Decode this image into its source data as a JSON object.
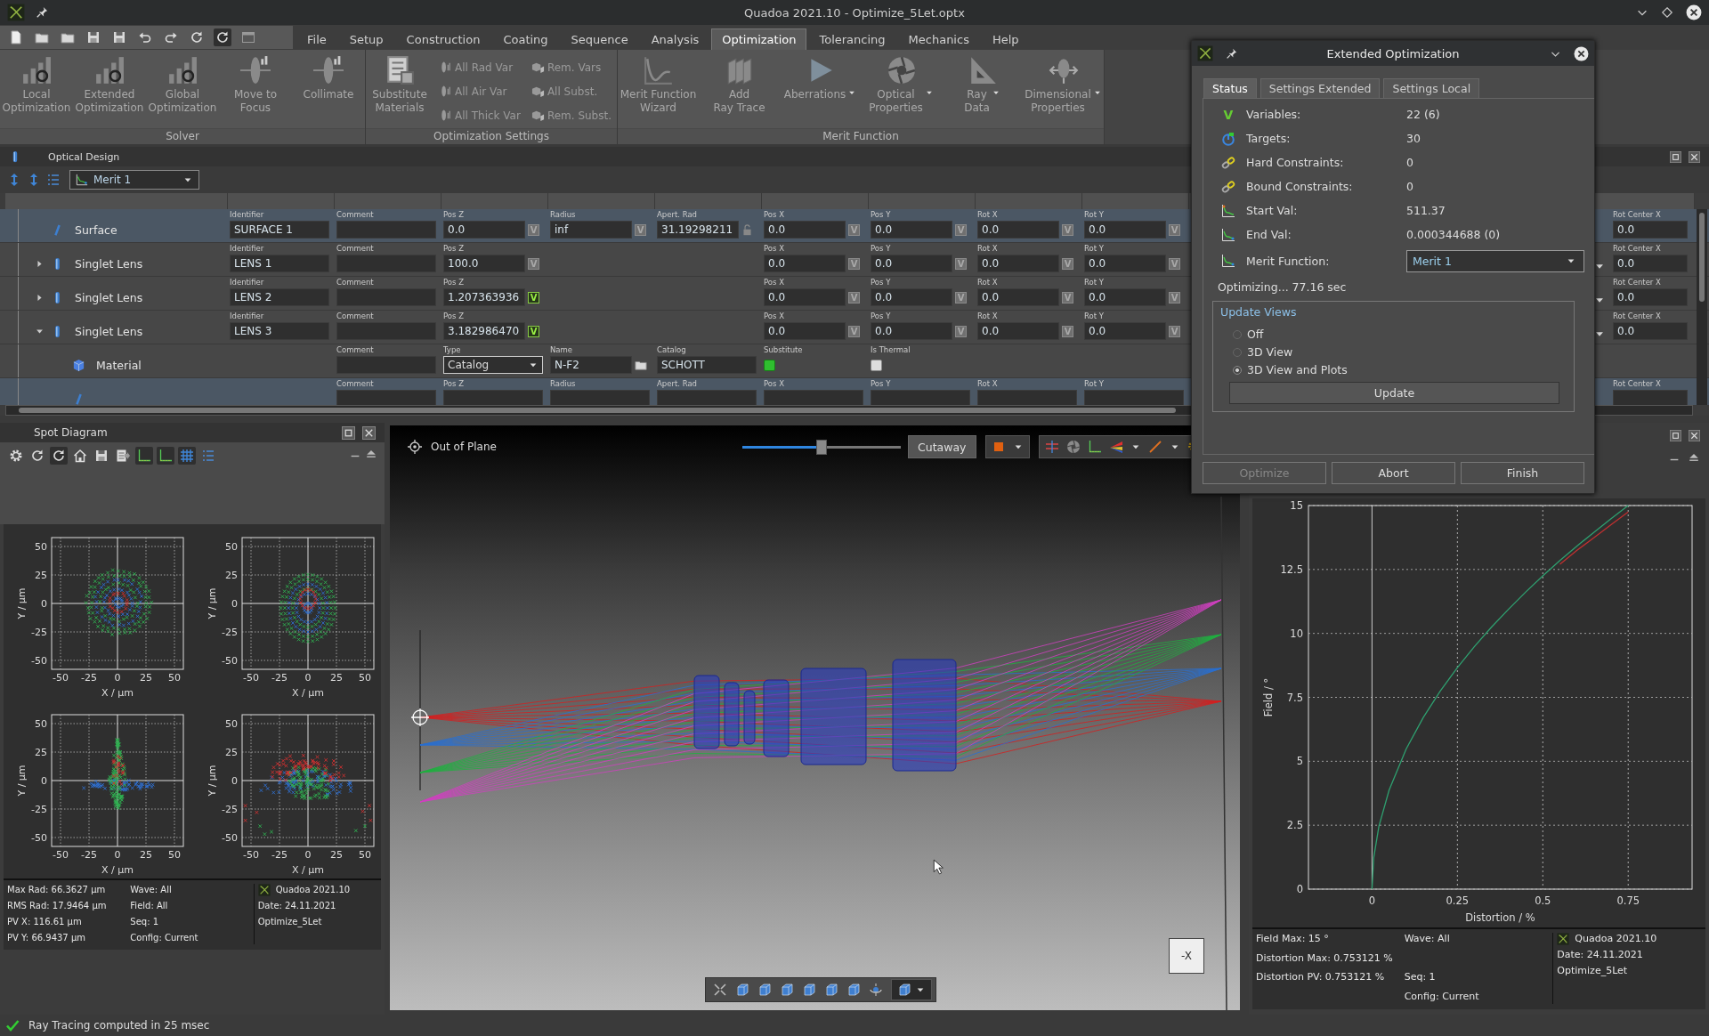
{
  "window": {
    "title": "Quadoa 2021.10 - Optimize_5Let.optx"
  },
  "menu": [
    {
      "label": "File",
      "selected": false
    },
    {
      "label": "Setup",
      "selected": false
    },
    {
      "label": "Construction",
      "selected": false
    },
    {
      "label": "Coating",
      "selected": false
    },
    {
      "label": "Sequence",
      "selected": false
    },
    {
      "label": "Analysis",
      "selected": false
    },
    {
      "label": "Optimization",
      "selected": true
    },
    {
      "label": "Tolerancing",
      "selected": false
    },
    {
      "label": "Mechanics",
      "selected": false
    },
    {
      "label": "Help",
      "selected": false
    }
  ],
  "ribbon": {
    "solver": {
      "title": "Solver",
      "buttons": [
        {
          "label": "Local\nOptimization",
          "dropdown": false
        },
        {
          "label": "Extended\nOptimization",
          "dropdown": false
        },
        {
          "label": "Global\nOptimization",
          "dropdown": false
        },
        {
          "label": "Move to\nFocus",
          "dropdown": false
        },
        {
          "label": "Collimate",
          "dropdown": false
        }
      ]
    },
    "settings": {
      "title": "Optimization Settings",
      "large": {
        "label": "Substitute\nMaterials"
      },
      "small": [
        {
          "label": "All Rad Var"
        },
        {
          "label": "All Air Var"
        },
        {
          "label": "All Thick Var"
        },
        {
          "label": "Rem. Vars"
        },
        {
          "label": "All Subst."
        },
        {
          "label": "Rem. Subst."
        }
      ]
    },
    "merit": {
      "title": "Merit Function",
      "buttons": [
        {
          "label": "Merit Function\nWizard",
          "dropdown": false
        },
        {
          "label": "Add\nRay Trace",
          "dropdown": false
        },
        {
          "label": "Aberrations",
          "dropdown": true
        },
        {
          "label": "Optical\nProperties",
          "dropdown": true
        },
        {
          "label": "Ray\nData",
          "dropdown": true
        },
        {
          "label": "Dimensional\nProperties",
          "dropdown": true
        }
      ]
    }
  },
  "optical_design": {
    "title": "Optical Design",
    "merit_select": "Merit 1",
    "rows": [
      {
        "kind": "surface",
        "name": "Surface",
        "selected": true,
        "hidden_dropdown": false,
        "fields": [
          {
            "kind": "text",
            "label": "Identifier",
            "value": "SURFACE 1"
          },
          {
            "kind": "text",
            "label": "Comment"
          },
          {
            "kind": "text",
            "label": "Pos Z",
            "value": "0.0",
            "var": "V",
            "checked": false
          },
          {
            "kind": "text",
            "label": "Radius",
            "value": "inf",
            "var": "V",
            "checked": false
          },
          {
            "kind": "locked",
            "label": "Apert. Rad",
            "value": "31.19298211"
          },
          {
            "kind": "text",
            "label": "Pos X",
            "value": "0.0",
            "var": "V",
            "checked": false
          },
          {
            "kind": "text",
            "label": "Pos Y",
            "value": "0.0",
            "var": "V",
            "checked": false
          },
          {
            "kind": "text",
            "label": "Rot X",
            "value": "0.0",
            "var": "V",
            "checked": false
          },
          {
            "kind": "text",
            "label": "Rot Y",
            "value": "0.0",
            "var": "V",
            "checked": false
          }
        ],
        "far_field": {
          "label": "Rot Center X",
          "value": "0.0"
        }
      },
      {
        "kind": "lens",
        "name": "Singlet Lens",
        "selected": false,
        "expanded": false,
        "hidden_dropdown": true,
        "fields": [
          {
            "kind": "text",
            "label": "Identifier",
            "value": "LENS 1"
          },
          {
            "kind": "text",
            "label": "Comment"
          },
          {
            "kind": "text",
            "label": "Pos Z",
            "value": "100.0",
            "var": "V",
            "checked": false
          },
          {
            "kind": "blank"
          },
          {
            "kind": "blank"
          },
          {
            "kind": "text",
            "label": "Pos X",
            "value": "0.0",
            "var": "V",
            "checked": false
          },
          {
            "kind": "text",
            "label": "Pos Y",
            "value": "0.0",
            "var": "V",
            "checked": false
          },
          {
            "kind": "text",
            "label": "Rot X",
            "value": "0.0",
            "var": "V",
            "checked": false
          },
          {
            "kind": "text",
            "label": "Rot Y",
            "value": "0.0",
            "var": "V",
            "checked": false
          }
        ],
        "far_field": {
          "label": "Rot Center X",
          "value": "0.0"
        }
      },
      {
        "kind": "lens",
        "name": "Singlet Lens",
        "selected": false,
        "expanded": false,
        "hidden_dropdown": true,
        "fields": [
          {
            "kind": "text",
            "label": "Identifier",
            "value": "LENS 2"
          },
          {
            "kind": "text",
            "label": "Comment"
          },
          {
            "kind": "text",
            "label": "Pos Z",
            "value": "1.207363936",
            "var": "V",
            "checked": true
          },
          {
            "kind": "blank"
          },
          {
            "kind": "blank"
          },
          {
            "kind": "text",
            "label": "Pos X",
            "value": "0.0",
            "var": "V",
            "checked": false
          },
          {
            "kind": "text",
            "label": "Pos Y",
            "value": "0.0",
            "var": "V",
            "checked": false
          },
          {
            "kind": "text",
            "label": "Rot X",
            "value": "0.0",
            "var": "V",
            "checked": false
          },
          {
            "kind": "text",
            "label": "Rot Y",
            "value": "0.0",
            "var": "V",
            "checked": false
          }
        ],
        "far_field": {
          "label": "Rot Center X",
          "value": "0.0"
        }
      },
      {
        "kind": "lens",
        "name": "Singlet Lens",
        "selected": false,
        "expanded": true,
        "hidden_dropdown": true,
        "fields": [
          {
            "kind": "text",
            "label": "Identifier",
            "value": "LENS 3"
          },
          {
            "kind": "text",
            "label": "Comment"
          },
          {
            "kind": "text",
            "label": "Pos Z",
            "value": "3.182986470",
            "var": "V",
            "checked": true
          },
          {
            "kind": "blank"
          },
          {
            "kind": "blank"
          },
          {
            "kind": "text",
            "label": "Pos X",
            "value": "0.0",
            "var": "V",
            "checked": false
          },
          {
            "kind": "text",
            "label": "Pos Y",
            "value": "0.0",
            "var": "V",
            "checked": false
          },
          {
            "kind": "text",
            "label": "Rot X",
            "value": "0.0",
            "var": "V",
            "checked": false
          },
          {
            "kind": "text",
            "label": "Rot Y",
            "value": "0.0",
            "var": "V",
            "checked": false
          }
        ],
        "far_field": {
          "label": "Rot Center X",
          "value": "0.0"
        },
        "children": [
          {
            "kind": "material",
            "name": "Material",
            "selected": false,
            "hidden_dropdown": false,
            "fields": [
              {
                "kind": "blank"
              },
              {
                "kind": "text",
                "label": "Comment"
              },
              {
                "kind": "dropdown",
                "label": "Type",
                "value": "Catalog"
              },
              {
                "kind": "file",
                "label": "Name",
                "value": "N-F2"
              },
              {
                "kind": "text",
                "label": "Catalog",
                "value": "SCHOTT"
              },
              {
                "kind": "checkbox",
                "label": "Substitute",
                "checked": true
              },
              {
                "kind": "checkbox",
                "label": "Is Thermal",
                "checked": false
              }
            ]
          },
          {
            "kind": "surface",
            "selected": true,
            "hidden_dropdown": false,
            "fields": [
              {
                "kind": "blank"
              },
              {
                "kind": "text",
                "label": "Comment"
              },
              {
                "kind": "text",
                "label": "Pos Z"
              },
              {
                "kind": "text",
                "label": "Radius"
              },
              {
                "kind": "text",
                "label": "Apert. Rad"
              },
              {
                "kind": "text",
                "label": "Pos X"
              },
              {
                "kind": "text",
                "label": "Pos Y"
              },
              {
                "kind": "text",
                "label": "Rot X"
              },
              {
                "kind": "text",
                "label": "Rot Y"
              }
            ],
            "far_field": {
              "label": "Rot Center X"
            }
          }
        ]
      }
    ]
  },
  "spot_diagram": {
    "title": "Spot Diagram",
    "plots": [
      {
        "kind": "round",
        "x_ticks": [
          "-50",
          "-25",
          "0",
          "25",
          "50"
        ],
        "y_ticks": [
          "50",
          "25",
          "0",
          "-25",
          "-50"
        ],
        "x_label": "X / µm",
        "y_label": "Y / µm"
      },
      {
        "kind": "oval",
        "x_ticks": [
          "-50",
          "-25",
          "0",
          "25",
          "50"
        ],
        "y_ticks": [
          "50",
          "25",
          "0",
          "-25",
          "-50"
        ],
        "x_label": "X / µm",
        "y_label": "Y / µm"
      },
      {
        "kind": "star",
        "x_ticks": [
          "-50",
          "-25",
          "0",
          "25",
          "50"
        ],
        "y_ticks": [
          "50",
          "25",
          "0",
          "-25",
          "-50"
        ],
        "x_label": "X / µm",
        "y_label": "Y / µm"
      },
      {
        "kind": "fan",
        "x_ticks": [
          "-50",
          "-25",
          "0",
          "25",
          "50"
        ],
        "y_ticks": [
          "50",
          "25",
          "0",
          "-25",
          "-50"
        ],
        "x_label": "X / µm",
        "y_label": "Y / µm"
      }
    ],
    "footer": {
      "rows": [
        {
          "col_1": "Max Rad: 66.3627 µm",
          "col_2": "Wave: All"
        },
        {
          "col_1": "RMS Rad: 17.9464 µm",
          "col_2": "Field: All"
        },
        {
          "col_1": "PV X: 116.61 µm",
          "col_2": "Seq: 1"
        },
        {
          "col_1": "PV Y: 66.9437 µm",
          "col_2": "Config: Current"
        }
      ],
      "brand": [
        "Quadoa 2021.10",
        "Date: 24.11.2021",
        "Optimize_5Let"
      ]
    }
  },
  "view_3d": {
    "title": "Out of Plane",
    "slider": {
      "level": 0.5
    },
    "cutaway": "Cutaway",
    "axis_button": "-X"
  },
  "distortion": {
    "chart_data": {
      "type": "line",
      "xlabel": "Distortion / %",
      "ylabel": "Field / °",
      "x": [
        0,
        0.005,
        0.02,
        0.05,
        0.1,
        0.15,
        0.2,
        0.25,
        0.3,
        0.35,
        0.4,
        0.45,
        0.5,
        0.55,
        0.6,
        0.65,
        0.7,
        0.75
      ],
      "series": [
        {
          "color": "#2fa070",
          "values": [
            0,
            1.22,
            2.45,
            3.87,
            5.48,
            6.71,
            7.75,
            8.66,
            9.49,
            10.25,
            10.95,
            11.62,
            12.25,
            12.85,
            13.42,
            13.96,
            14.49,
            15
          ]
        },
        {
          "color": "#c03030",
          "values": [
            null,
            null,
            null,
            null,
            null,
            null,
            null,
            null,
            null,
            null,
            null,
            null,
            null,
            12.7,
            13.25,
            13.75,
            14.25,
            14.75
          ]
        }
      ],
      "xlim": [
        -0.186,
        0.937
      ],
      "ylim": [
        0,
        15
      ],
      "xticks": [
        0,
        0.25,
        0.5,
        0.75
      ],
      "yticks": [
        0,
        2.5,
        5,
        7.5,
        10,
        12.5,
        15
      ],
      "grid": true
    },
    "footer": {
      "rows": [
        {
          "col_1": "Field Max: 15 °",
          "col_2": "Wave: All"
        },
        {
          "col_1": "Distortion Max: 0.753121 %"
        },
        {
          "col_1": "Distortion PV: 0.753121 %",
          "col_2": "Seq: 1"
        },
        {
          "col_2": "Config: Current"
        }
      ],
      "brand": [
        "Quadoa 2021.10",
        "Date: 24.11.2021",
        "Optimize_5Let"
      ]
    }
  },
  "dialog": {
    "title": "Extended Optimization",
    "tabs": [
      {
        "label": "Status",
        "selected": true
      },
      {
        "label": "Settings Extended",
        "selected": false
      },
      {
        "label": "Settings Local",
        "selected": false
      }
    ],
    "rows": [
      {
        "kind": "variables",
        "glyph": "V",
        "label": "Variables:",
        "value": "22 (6)"
      },
      {
        "kind": "targets",
        "label": "Targets:",
        "value": "30"
      },
      {
        "kind": "hard",
        "label": "Hard Constraints:",
        "value": "0"
      },
      {
        "kind": "bound",
        "label": "Bound Constraints:",
        "value": "0"
      },
      {
        "kind": "start",
        "label": "Start Val:",
        "value": "511.37"
      },
      {
        "kind": "end",
        "label": "End Val:",
        "value": "0.000344688 (0)"
      }
    ],
    "merit": {
      "label": "Merit Function:",
      "value": "Merit 1"
    },
    "status": "Optimizing... 77.16 sec",
    "update_views": {
      "title": "Update Views",
      "options": [
        {
          "label": "Off",
          "selected": false
        },
        {
          "label": "3D View",
          "selected": false
        },
        {
          "label": "3D View and Plots",
          "selected": true
        }
      ],
      "button": "Update"
    },
    "buttons": [
      {
        "label": "Optimize",
        "disabled": true
      },
      {
        "label": "Abort",
        "disabled": false
      },
      {
        "label": "Finish",
        "disabled": false
      }
    ]
  },
  "status_bar": {
    "text": "Ray Tracing computed in 25 msec"
  }
}
